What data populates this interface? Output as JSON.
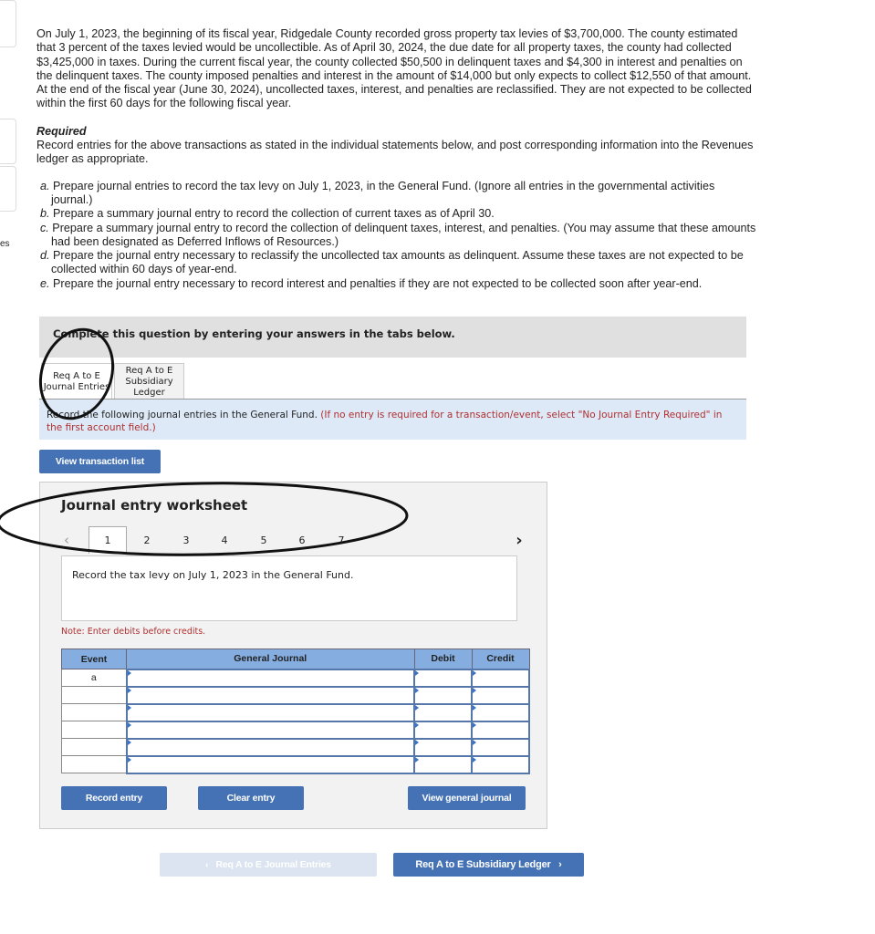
{
  "sidebar": {
    "partial_text": "es"
  },
  "problem": {
    "paragraph": "On July 1, 2023, the beginning of its fiscal year, Ridgedale County recorded gross property tax levies of $3,700,000. The county estimated that 3 percent of the taxes levied would be uncollectible. As of April 30, 2024, the due date for all property taxes, the county had collected $3,425,000 in taxes. During the current fiscal year, the county collected $50,500 in delinquent taxes and $4,300 in interest and penalties on the delinquent taxes. The county imposed penalties and interest in the amount of $14,000 but only expects to collect $12,550 of that amount. At the end of the fiscal year (June 30, 2024), uncollected taxes, interest, and penalties are reclassified. They are not expected to be collected within the first 60 days for the following fiscal year.",
    "required_heading": "Required",
    "required_text": "Record entries for the above transactions as stated in the individual statements below, and post corresponding information into the Revenues ledger as appropriate.",
    "items": [
      {
        "letter": "a.",
        "text": "Prepare journal entries to record the tax levy on July 1, 2023, in the General Fund. (Ignore all entries in the governmental activities journal.)"
      },
      {
        "letter": "b.",
        "text": "Prepare a summary journal entry to record the collection of current taxes as of April 30."
      },
      {
        "letter": "c.",
        "text": "Prepare a summary journal entry to record the collection of delinquent taxes, interest, and penalties. (You may assume that these amounts had been designated as Deferred Inflows of Resources.)"
      },
      {
        "letter": "d.",
        "text": "Prepare the journal entry necessary to reclassify the uncollected tax amounts as delinquent. Assume these taxes are not expected to be collected within 60 days of year-end."
      },
      {
        "letter": "e.",
        "text": "Prepare the journal entry necessary to record interest and penalties if they are not expected to be collected soon after year-end."
      }
    ]
  },
  "instructions": "Complete this question by entering your answers in the tabs below.",
  "tabs": [
    {
      "label": "Req A to E Journal Entries",
      "active": true
    },
    {
      "label": "Req A to E Subsidiary Ledger",
      "active": false
    }
  ],
  "band": {
    "text": "Record the following journal entries in the General Fund.",
    "note": "(If no entry is required for a transaction/event, select \"No Journal Entry Required\" in the first account field.)"
  },
  "view_transaction_list": "View transaction list",
  "worksheet": {
    "title": "Journal entry worksheet",
    "pages": [
      "1",
      "2",
      "3",
      "4",
      "5",
      "6",
      "7"
    ],
    "current_page": "1",
    "prev_icon": "chevron-left",
    "next_icon": "chevron-right",
    "instruction": "Record the tax levy on July 1, 2023 in the General Fund.",
    "note": "Note: Enter debits before credits.",
    "columns": [
      "Event",
      "General Journal",
      "Debit",
      "Credit"
    ],
    "rows": [
      {
        "event": "a"
      },
      {
        "event": ""
      },
      {
        "event": ""
      },
      {
        "event": ""
      },
      {
        "event": ""
      },
      {
        "event": ""
      }
    ],
    "buttons": {
      "record": "Record entry",
      "clear": "Clear entry",
      "view_journal": "View general journal"
    }
  },
  "nav": {
    "prev": "Req A to E Journal Entries",
    "next": "Req A to E Subsidiary Ledger"
  },
  "colors": {
    "button": "#4472b4",
    "header": "#85ade0",
    "band": "#dde9f7",
    "note_red": "#b03030"
  }
}
